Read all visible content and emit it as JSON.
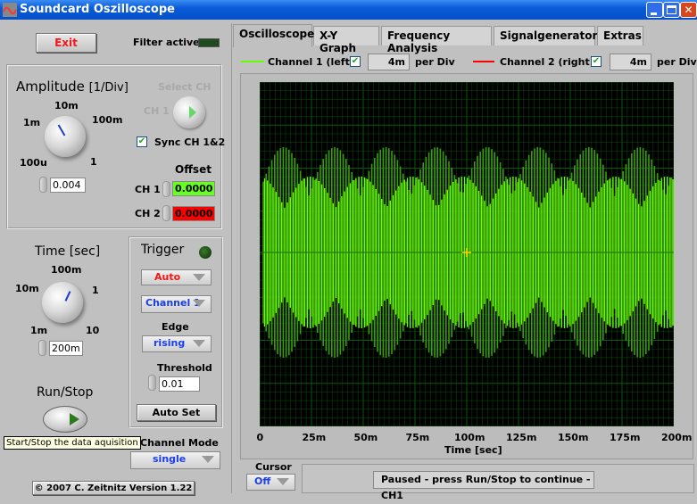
{
  "window": {
    "title": "Soundcard Oszilloscope"
  },
  "left": {
    "exit": "Exit",
    "filter_active": "Filter active",
    "amplitude": {
      "title": "Amplitude",
      "unit": "[1/Div]",
      "ticks": [
        "100u",
        "1m",
        "10m",
        "100m",
        "1"
      ],
      "value": "0.004"
    },
    "select_ch": {
      "label": "Select CH",
      "ch": "CH 1"
    },
    "sync": {
      "label": "Sync CH 1&2",
      "checked": true
    },
    "offset": {
      "title": "Offset",
      "ch1_label": "CH 1",
      "ch1": "0.0000",
      "ch2_label": "CH 2",
      "ch2": "0.0000"
    },
    "time": {
      "title": "Time [sec]",
      "ticks": [
        "1m",
        "10m",
        "100m",
        "1",
        "10"
      ],
      "value": "200m"
    },
    "trigger": {
      "title": "Trigger",
      "mode": "Auto",
      "channel": "Channel 1",
      "edge_label": "Edge",
      "edge": "rising",
      "threshold_label": "Threshold",
      "threshold": "0.01",
      "autoset": "Auto Set"
    },
    "runstop": "Run/Stop",
    "tooltip": "Start/Stop the data aquisition",
    "channel_mode": {
      "label": "Channel Mode",
      "value": "single"
    },
    "copyright": "© 2007  C. Zeitnitz Version 1.22"
  },
  "tabs": [
    "Oscilloscope",
    "X-Y Graph",
    "Frequency Analysis",
    "Signalgenerator",
    "Extras"
  ],
  "active_tab": 0,
  "channels": [
    {
      "label": "Channel 1 (left)",
      "checked": true,
      "per_div": "4m",
      "per_div_label": "per Div",
      "color": "#66ff00"
    },
    {
      "label": "Channel 2 (right)",
      "checked": true,
      "per_div": "4m",
      "per_div_label": "per Div",
      "color": "#ff0000"
    }
  ],
  "plot": {
    "xlabel": "Time [sec]",
    "xticks": [
      "0",
      "25m",
      "50m",
      "75m",
      "100m",
      "125m",
      "150m",
      "175m",
      "200m"
    ],
    "background": "#000000",
    "grid": "#0a5a0a"
  },
  "cursor": {
    "label": "Cursor",
    "value": "Off"
  },
  "status": "Paused - press Run/Stop to continue - CH1"
}
